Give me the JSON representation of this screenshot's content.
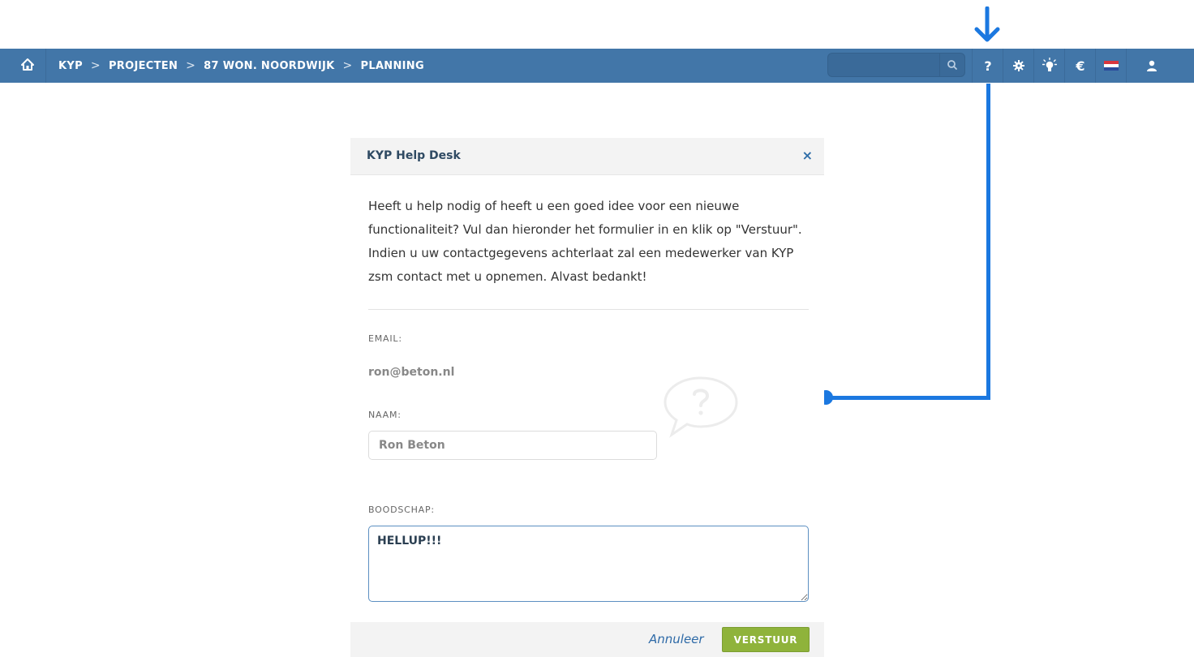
{
  "nav": {
    "home_icon": "home-icon",
    "breadcrumb": [
      "KYP",
      "PROJECTEN",
      "87 WON. NOORDWIJK",
      "PLANNING"
    ],
    "separator": ">",
    "search_placeholder": "",
    "help_label": "?",
    "euro_label": "€",
    "icons": [
      "search-icon",
      "help-icon",
      "gear-icon",
      "lightbulb-icon",
      "euro-icon",
      "dutch-flag-icon",
      "user-icon"
    ]
  },
  "modal": {
    "title": "KYP Help Desk",
    "close_label": "×",
    "intro": "Heeft u help nodig of heeft u een goed idee voor een nieuwe functionaliteit? Vul dan hieronder het formulier in en klik op \"Verstuur\". Indien u uw contactgegevens achterlaat zal een medewerker van KYP zsm contact met u opnemen. Alvast bedankt!",
    "email_label": "EMAIL:",
    "email_value": "ron@beton.nl",
    "name_label": "NAAM:",
    "name_value": "Ron Beton",
    "message_label": "BOODSCHAP:",
    "message_value": "HELLUP!!!",
    "cancel_label": "Annuleer",
    "send_label": "VERSTUUR"
  },
  "colors": {
    "nav_bar": "#4276a8",
    "accent_annotation": "#1b78e0",
    "send_button": "#8fb33b"
  }
}
